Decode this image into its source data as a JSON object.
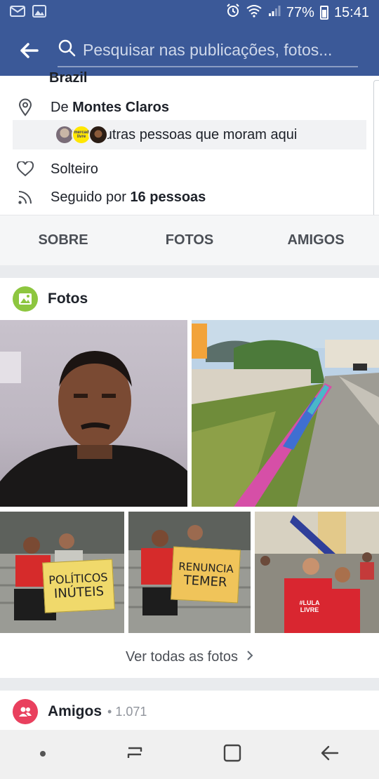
{
  "status": {
    "battery": "77%",
    "time": "15:41"
  },
  "header": {
    "search_placeholder": "Pesquisar nas publicações, fotos..."
  },
  "intro": {
    "partial_top": "Brazil",
    "from_prefix": "De",
    "from_city": "Montes Claros",
    "others_label": "Ver outras pessoas que moram aqui",
    "relationship": "Solteiro",
    "followed_prefix": "Seguido por",
    "followed_count": "16 pessoas",
    "avatar_badge": "mercad livre"
  },
  "tabs": [
    "SOBRE",
    "FOTOS",
    "AMIGOS"
  ],
  "photos": {
    "title": "Fotos",
    "view_all": "Ver todas as fotos",
    "sign_1": [
      "POLÍTICOS",
      "INÚTEIS"
    ],
    "sign_2": [
      "RENUNCIA",
      "TEMER"
    ],
    "shirt": [
      "#LULA",
      "LIVRE"
    ]
  },
  "friends": {
    "title": "Amigos",
    "count": "• 1.071"
  },
  "colors": {
    "brand": "#3b5998",
    "photos_icon": "#8dc63f",
    "friends_icon": "#e9405e"
  }
}
